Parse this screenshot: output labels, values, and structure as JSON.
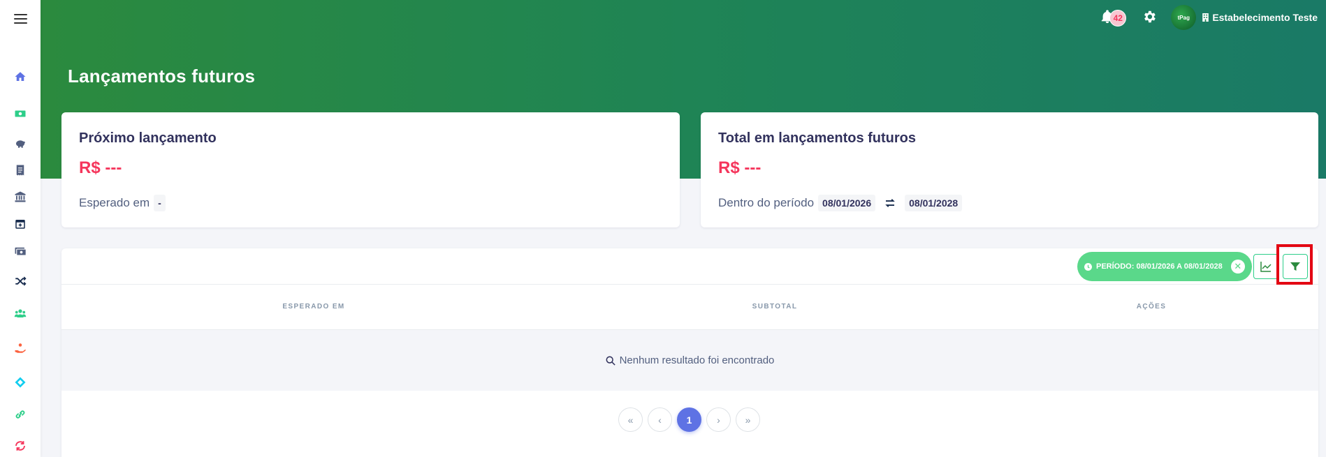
{
  "header": {
    "page_title": "Lançamentos futuros",
    "notifications_count": "42",
    "avatar_text": "tPag",
    "user_name": "Estabelecimento Teste"
  },
  "sidebar": {
    "items": [
      {
        "icon": "home-icon",
        "color": "#5e72e4"
      },
      {
        "icon": "money-icon",
        "color": "#2dce89"
      },
      {
        "icon": "piggy-bank-icon",
        "color": "#525f7f"
      },
      {
        "icon": "receipt-icon",
        "color": "#525f7f"
      },
      {
        "icon": "bank-icon",
        "color": "#525f7f"
      },
      {
        "icon": "calendar-plus-icon",
        "color": "#172b4d"
      },
      {
        "icon": "money-check-icon",
        "color": "#525f7f"
      },
      {
        "icon": "shuffle-icon",
        "color": "#172b4d"
      },
      {
        "icon": "users-icon",
        "color": "#2dce89"
      },
      {
        "icon": "hand-coin-icon",
        "color": "#fb6340"
      },
      {
        "icon": "pix-icon",
        "color": "#11cdef"
      },
      {
        "icon": "link-icon",
        "color": "#2dce89"
      },
      {
        "icon": "sync-icon",
        "color": "#f5365c"
      }
    ]
  },
  "cards": {
    "next": {
      "title": "Próximo lançamento",
      "amount": "R$ ---",
      "label": "Esperado em",
      "value": "-"
    },
    "total": {
      "title": "Total em lançamentos futuros",
      "amount": "R$ ---",
      "label": "Dentro do período",
      "date_start": "08/01/2026",
      "date_end": "08/01/2028"
    }
  },
  "table": {
    "filter_chip": "PERÍODO: 08/01/2026 A 08/01/2028",
    "columns": [
      "ESPERADO EM",
      "SUBTOTAL",
      "AÇÕES"
    ],
    "empty_message": "Nenhum resultado foi encontrado",
    "pagination": {
      "first": "«",
      "prev": "‹",
      "current": "1",
      "next": "›",
      "last": "»"
    }
  },
  "colors": {
    "primary": "#5e72e4",
    "success": "#2dce89",
    "danger": "#f5365c",
    "header_gradient_start": "#2b8a3e",
    "header_gradient_end": "#1a7a66",
    "highlight": "#e30613"
  }
}
